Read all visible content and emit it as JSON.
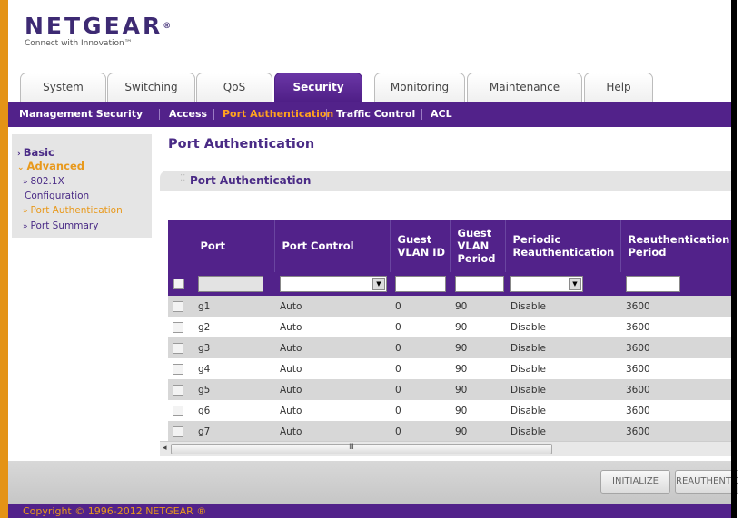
{
  "brand": {
    "name": "NETGEAR",
    "reg": "®",
    "tagline": "Connect with Innovation™"
  },
  "tabs": [
    {
      "label": "System"
    },
    {
      "label": "Switching"
    },
    {
      "label": "QoS"
    },
    {
      "label": "Security",
      "active": true
    },
    {
      "label": "Monitoring"
    },
    {
      "label": "Maintenance"
    },
    {
      "label": "Help"
    }
  ],
  "subnav": [
    {
      "label": "Management Security"
    },
    {
      "label": "Access"
    },
    {
      "label": "Port Authentication",
      "active": true
    },
    {
      "label": "Traffic Control"
    },
    {
      "label": "ACL"
    }
  ],
  "leftnav": {
    "basic": "Basic",
    "advanced": "Advanced",
    "items": [
      {
        "label": "802.1X"
      },
      {
        "label": "Configuration"
      },
      {
        "label": "Port Authentication",
        "active": true
      },
      {
        "label": "Port Summary"
      }
    ]
  },
  "page_title": "Port Authentication",
  "section_title": "Port Authentication",
  "table": {
    "headers": {
      "port": "Port",
      "port_control": "Port Control",
      "guest_vlan_id_1": "Guest",
      "guest_vlan_id_2": "VLAN ID",
      "guest_vlan_period_1": "Guest",
      "guest_vlan_period_2": "VLAN",
      "guest_vlan_period_3": "Period",
      "periodic_reauth_1": "Periodic",
      "periodic_reauth_2": "Reauthentication",
      "reauth_period_1": "Reauthentication",
      "reauth_period_2": "Period"
    },
    "rows": [
      {
        "port": "g1",
        "control": "Auto",
        "vlan_id": "0",
        "vlan_period": "90",
        "periodic": "Disable",
        "reauth_period": "3600"
      },
      {
        "port": "g2",
        "control": "Auto",
        "vlan_id": "0",
        "vlan_period": "90",
        "periodic": "Disable",
        "reauth_period": "3600"
      },
      {
        "port": "g3",
        "control": "Auto",
        "vlan_id": "0",
        "vlan_period": "90",
        "periodic": "Disable",
        "reauth_period": "3600"
      },
      {
        "port": "g4",
        "control": "Auto",
        "vlan_id": "0",
        "vlan_period": "90",
        "periodic": "Disable",
        "reauth_period": "3600"
      },
      {
        "port": "g5",
        "control": "Auto",
        "vlan_id": "0",
        "vlan_period": "90",
        "periodic": "Disable",
        "reauth_period": "3600"
      },
      {
        "port": "g6",
        "control": "Auto",
        "vlan_id": "0",
        "vlan_period": "90",
        "periodic": "Disable",
        "reauth_period": "3600"
      },
      {
        "port": "g7",
        "control": "Auto",
        "vlan_id": "0",
        "vlan_period": "90",
        "periodic": "Disable",
        "reauth_period": "3600"
      }
    ]
  },
  "scrollbar": {
    "grip": "III"
  },
  "buttons": {
    "initialize": "INITIALIZE",
    "reauthenticate": "REAUTHENTICA"
  },
  "footer": {
    "copyright": "Copyright © 1996-2012 NETGEAR ®"
  },
  "colors": {
    "purple": "#52228a",
    "orange": "#e49316",
    "accent_text": "#e8991c"
  }
}
